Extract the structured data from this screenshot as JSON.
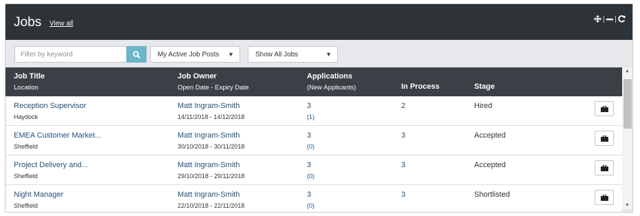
{
  "header": {
    "title": "Jobs",
    "view_all": "View all",
    "controls": [
      "move-icon",
      "minimize-icon",
      "refresh-icon"
    ]
  },
  "filters": {
    "search_placeholder": "Filter by keyword",
    "search_icon": "search-icon",
    "select1": "My Active Job Posts",
    "select2": "Show All Jobs"
  },
  "columns": {
    "job_title": "Job Title",
    "location": "Location",
    "job_owner": "Job Owner",
    "dates": "Open Date - Expiry Date",
    "applications": "Applications",
    "new_applicants": "(New Applicants)",
    "in_process": "In Process",
    "stage": "Stage"
  },
  "rows": [
    {
      "title": "Reception Supervisor",
      "location": "Haydock",
      "owner": "Matt Ingram-Smith",
      "dates": "14/11/2018 - 14/12/2018",
      "applications": "3",
      "new_applicants": "(1)",
      "in_process": "2",
      "stage": "Hired"
    },
    {
      "title": "EMEA Customer Market...",
      "location": "Sheffield",
      "owner": "Matt Ingram-Smith",
      "dates": "30/10/2018 - 30/11/2018",
      "applications": "3",
      "new_applicants": "(0)",
      "in_process": "3",
      "stage": "Accepted"
    },
    {
      "title": "Project Delivery and...",
      "location": "Sheffield",
      "owner": "Matt Ingram-Smith",
      "dates": "29/10/2018 - 29/11/2018",
      "applications": "3",
      "new_applicants": "(0)",
      "in_process": "3",
      "stage": "Accepted"
    },
    {
      "title": "Night Manager",
      "location": "Sheffield",
      "owner": "Matt Ingram-Smith",
      "dates": "22/10/2018 - 22/11/2018",
      "applications": "3",
      "new_applicants": "(0)",
      "in_process": "3",
      "stage": "Shortlisted"
    }
  ],
  "row_action_icon": "briefcase-icon",
  "colors": {
    "header_bg": "#2e3338",
    "table_header_bg": "#3b4047",
    "search_button": "#6bb6c8",
    "link": "#1f4e79"
  }
}
